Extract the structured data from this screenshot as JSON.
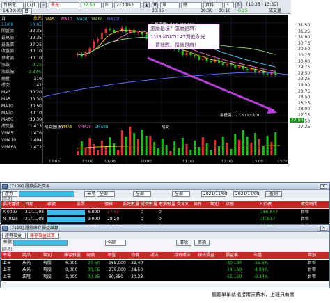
{
  "toolbar": {
    "symbol": "2330",
    "symbol_name": "台積電",
    "code": "[7]1",
    "stock_name": "永光",
    "price": "27.50",
    "qty": "B",
    "value": "213,893",
    "time_1": "30:35",
    "time_2": "30:30",
    "time_3": "30:10",
    "range": "[10:35 - 13:30]",
    "ref": "3",
    "change": "-0.25",
    "label_tick": "單",
    "label_total": "總",
    "label_data": "資料",
    "label_amount": "成交量",
    "time_label": "14:30:00",
    "sub_label": "日",
    "legend_ma": [
      "MA5",
      "MA10",
      "MA20",
      "MA60",
      "MA120"
    ]
  },
  "left_panel": {
    "title_left": "台",
    "title_right": "永光",
    "date": "11/08",
    "time": "10:05",
    "rows": [
      {
        "k": "開盤價",
        "v": "30.35"
      },
      {
        "k": "最高價",
        "v": "30.35"
      },
      {
        "k": "最低價",
        "v": "27.25"
      },
      {
        "k": "收盤價",
        "v": "30.10"
      },
      {
        "k": "參考價",
        "v": "30.10"
      },
      {
        "k": "漲跌",
        "v": "-0.25"
      },
      {
        "k": "漲跌幅",
        "v": "-0.83%"
      },
      {
        "k": "總量",
        "v": "319"
      },
      {
        "k": "成交",
        "v": "42"
      },
      {
        "k": "MA3",
        "v": "30.20"
      },
      {
        "k": "MA5",
        "v": "30.30"
      },
      {
        "k": "MA10",
        "v": "30.50"
      },
      {
        "k": "MA20",
        "v": "30.10"
      },
      {
        "k": "MA60",
        "v": "30.30"
      },
      {
        "k": "成交量",
        "v": "1,413"
      },
      {
        "k": "VMA5",
        "v": "1,476"
      },
      {
        "k": "VMA10",
        "v": "1,404"
      },
      {
        "k": "VMA60",
        "v": "1,472"
      }
    ]
  },
  "chart_data": {
    "type": "line",
    "title": "",
    "x_labels": [
      "12:05",
      "13:00",
      "11/08",
      "10:00",
      "11:00",
      "12:00",
      "13:00",
      "13:30"
    ],
    "y_ticks": [
      "31.50",
      "31.25",
      "31.00",
      "30.75",
      "30.50",
      "30.25",
      "30.00",
      "29.75",
      "29.50",
      "29.25",
      "29.00",
      "28.75",
      "28.50",
      "28.25",
      "28.00",
      "27.75",
      "27.50",
      "27.25"
    ],
    "ylim": [
      27.25,
      31.5
    ],
    "high_label": "最高價：31.5 (09:10)",
    "low_label": "最低價：27.5 (13:10)",
    "current_price": "27.50",
    "kbar_label": "K線",
    "volume_label": "成交量",
    "vol_legend": [
      "成交量(張)",
      "VMA5",
      "VMA20",
      "VMA60"
    ],
    "vol_title": "成交"
  },
  "annotation": {
    "line1": "怎麼是墳？怎麼是麻？",
    "line2": "11/8 KOKO147買進永光",
    "line3": "一買就跌、猜就是麻！"
  },
  "order_window": {
    "title": "[7109] 證券委託交易",
    "tabs": [
      "證券",
      "市場",
      "全部",
      "全部",
      "全部"
    ],
    "date_from": "2021/11/08",
    "date_to": "2021/11/08",
    "query": "查詢",
    "section": "[訊息]",
    "headers": [
      "委託書號",
      "日期",
      "帳號",
      "股票",
      "價格",
      "委託數量",
      "成交數量",
      "取消數量",
      "交易別",
      "條件",
      "類別",
      "狀態",
      "入扣帳",
      "成交時間"
    ],
    "rows": [
      {
        "id": "X-0027",
        "date": "21/11/08",
        "qty": "6,000",
        "price": "27.50",
        "fill": "0",
        "cancel": "0",
        "amt": "-166,847",
        "status": "台幣"
      },
      {
        "id": "N-0025",
        "date": "21/11/08",
        "qty": "9,000",
        "price": "28.20",
        "fill": "0",
        "cancel": "0",
        "amt": "-10,817",
        "status": "台幣"
      },
      {
        "id": "X-0318",
        "date": "21/11/08",
        "qty": "1,000",
        "price": "30.35",
        "fill": "0",
        "cancel": "0",
        "amt": "-30,399",
        "status": "台幣"
      }
    ]
  },
  "stock_window": {
    "title": "[7110] 證券庫存損益試算",
    "tabs": [
      "證券損益",
      "庫存損益試算"
    ],
    "account_label": "帳號",
    "select_label": "全部",
    "btn_clear": "清除",
    "btn_query": "查詢",
    "section": "[訊息]",
    "headers": [
      "市場",
      "商品",
      "類別",
      "庫存數量",
      "現價",
      "市值",
      "均價",
      "成本",
      "持有成本",
      "預估損益",
      "損益率",
      "出借",
      "幣別"
    ],
    "rows": [
      {
        "market": "上市",
        "name": "永光",
        "type": "現股",
        "qty": "6,000",
        "price": "27.50",
        "value": "165,000",
        "avg": "32.40",
        "pl": "-30,134",
        "plr": "-15.6%",
        "cur": "台幣"
      },
      {
        "market": "上市",
        "name": "永光",
        "type": "現股",
        "qty": "9,000",
        "price": "30.55",
        "value": "275,000",
        "avg": "28.50",
        "pl": "-14,160",
        "plr": "-4.84%",
        "cur": "台幣"
      },
      {
        "market": "上市",
        "name": "正隆",
        "type": "現股",
        "qty": "1,000",
        "price": "30.35",
        "value": "30,350",
        "avg": "30.33",
        "pl": "-51,160",
        "plr": "-0.34%",
        "cur": "台幣"
      }
    ]
  },
  "footer": "聽聽單單就福接兩天薪水，上班只有閒"
}
